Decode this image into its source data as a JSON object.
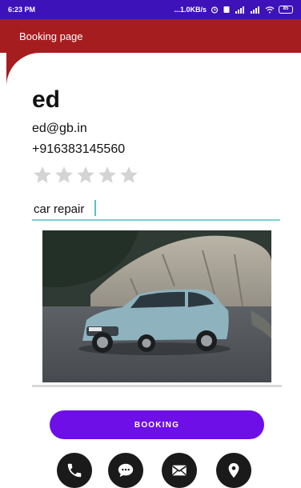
{
  "status_bar": {
    "time": "6:23 PM",
    "network_speed": "...1.0KB/s",
    "battery": "85",
    "background_color": "#3d12b8"
  },
  "app_bar": {
    "title": "Booking page",
    "background_color": "#a61d20"
  },
  "profile": {
    "name": "ed",
    "email": "ed@gb.in",
    "phone": "+916383145560",
    "rating": 0,
    "rating_max": 5
  },
  "service_input": {
    "value": "car repair"
  },
  "image": {
    "subject": "car-photo"
  },
  "actions": {
    "booking_label": "BOOKING",
    "booking_color": "#6d0fe6",
    "icons": [
      "phone-icon",
      "chat-icon",
      "mail-icon",
      "location-icon"
    ]
  }
}
